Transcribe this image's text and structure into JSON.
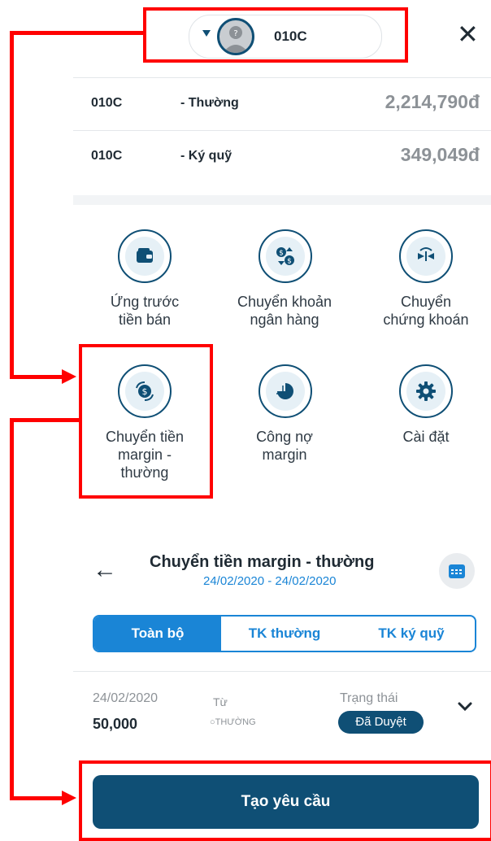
{
  "header": {
    "account_selector": "010C"
  },
  "balances": [
    {
      "account": "010C",
      "type": "- Thường",
      "amount": "2,214,790đ"
    },
    {
      "account": "010C",
      "type": "- Ký quỹ",
      "amount": "349,049đ"
    }
  ],
  "features": [
    {
      "line1": "Ứng trước",
      "line2": "tiền bán",
      "line3": "",
      "icon": "wallet-icon"
    },
    {
      "line1": "Chuyển khoản",
      "line2": "ngân hàng",
      "line3": "",
      "icon": "money-transfer-icon"
    },
    {
      "line1": "Chuyển",
      "line2": "chứng khoán",
      "line3": "",
      "icon": "stock-transfer-icon"
    },
    {
      "line1": "Chuyển tiền",
      "line2": "margin -",
      "line3": "thường",
      "icon": "money-exchange-icon"
    },
    {
      "line1": "Công nợ",
      "line2": "margin",
      "line3": "",
      "icon": "pie-chart-icon"
    },
    {
      "line1": "Cài đặt",
      "line2": "",
      "line3": "",
      "icon": "gear-icon"
    }
  ],
  "transfer_page": {
    "title": "Chuyển tiền margin - thường",
    "date_range": "24/02/2020 - 24/02/2020",
    "tabs": [
      "Toàn bộ",
      "TK thường",
      "TK ký quỹ"
    ],
    "active_tab": 0,
    "transaction": {
      "date": "24/02/2020",
      "amount": "50,000",
      "from_label": "Từ",
      "from_value": "THƯỜNG",
      "status_label": "Trạng thái",
      "status": "Đã Duyệt"
    },
    "create_button": "Tạo yêu cầu"
  },
  "colors": {
    "primary": "#0f4f75",
    "accent_blue": "#1a85d6",
    "annotation_red": "#ff0000",
    "muted_text": "#8d9297"
  }
}
